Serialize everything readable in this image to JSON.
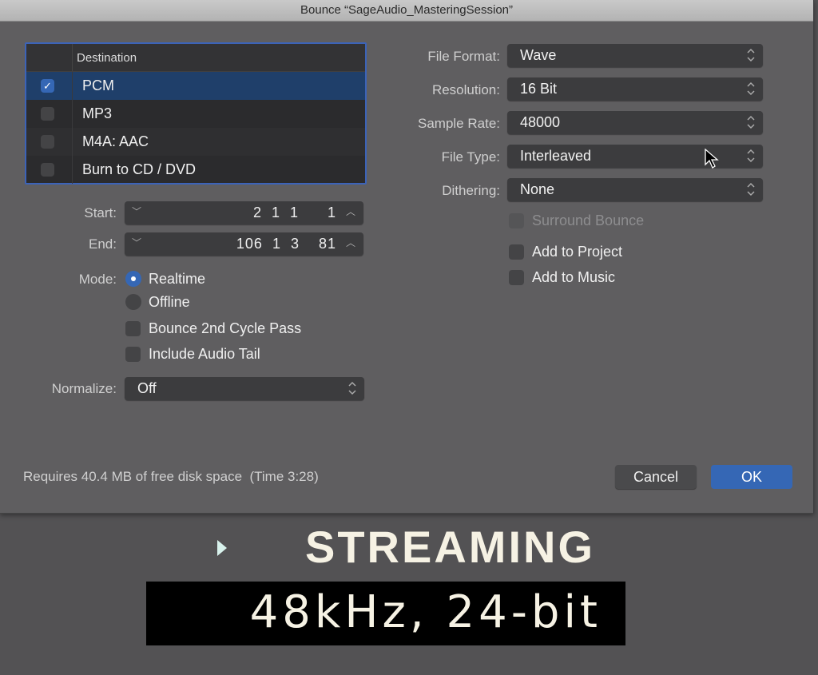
{
  "window": {
    "title": "Bounce “SageAudio_MasteringSession”"
  },
  "destination": {
    "header": "Destination",
    "rows": [
      {
        "label": "PCM",
        "checked": true
      },
      {
        "label": "MP3",
        "checked": false
      },
      {
        "label": "M4A: AAC",
        "checked": false
      },
      {
        "label": "Burn to CD / DVD",
        "checked": false
      }
    ]
  },
  "range": {
    "start_label": "Start:",
    "start_value": "2 1 1   1",
    "end_label": "End:",
    "end_value": "106 1 3  81"
  },
  "mode": {
    "label": "Mode:",
    "options": [
      {
        "label": "Realtime",
        "selected": true
      },
      {
        "label": "Offline",
        "selected": false
      }
    ]
  },
  "options_left": [
    {
      "label": "Bounce 2nd Cycle Pass",
      "checked": false
    },
    {
      "label": "Include Audio Tail",
      "checked": false
    }
  ],
  "normalize": {
    "label": "Normalize:",
    "value": "Off"
  },
  "format": {
    "file_format": {
      "label": "File Format:",
      "value": "Wave"
    },
    "resolution": {
      "label": "Resolution:",
      "value": "16 Bit"
    },
    "sample_rate": {
      "label": "Sample Rate:",
      "value": "48000"
    },
    "file_type": {
      "label": "File Type:",
      "value": "Interleaved"
    },
    "dithering": {
      "label": "Dithering:",
      "value": "None"
    }
  },
  "options_right": [
    {
      "label": "Surround Bounce",
      "checked": false,
      "disabled": true
    },
    {
      "label": "Add to Project",
      "checked": false,
      "disabled": false
    },
    {
      "label": "Add to Music",
      "checked": false,
      "disabled": false
    }
  ],
  "status": "Requires 40.4 MB of free disk space  (Time 3:28)",
  "buttons": {
    "cancel": "Cancel",
    "ok": "OK"
  },
  "overlay": {
    "title": "STREAMING",
    "spec": "48kHz, 24-bit"
  },
  "colors": {
    "accent": "#3567b5",
    "selection": "#1f3f6a",
    "overlay_text": "#f6f2e4"
  }
}
